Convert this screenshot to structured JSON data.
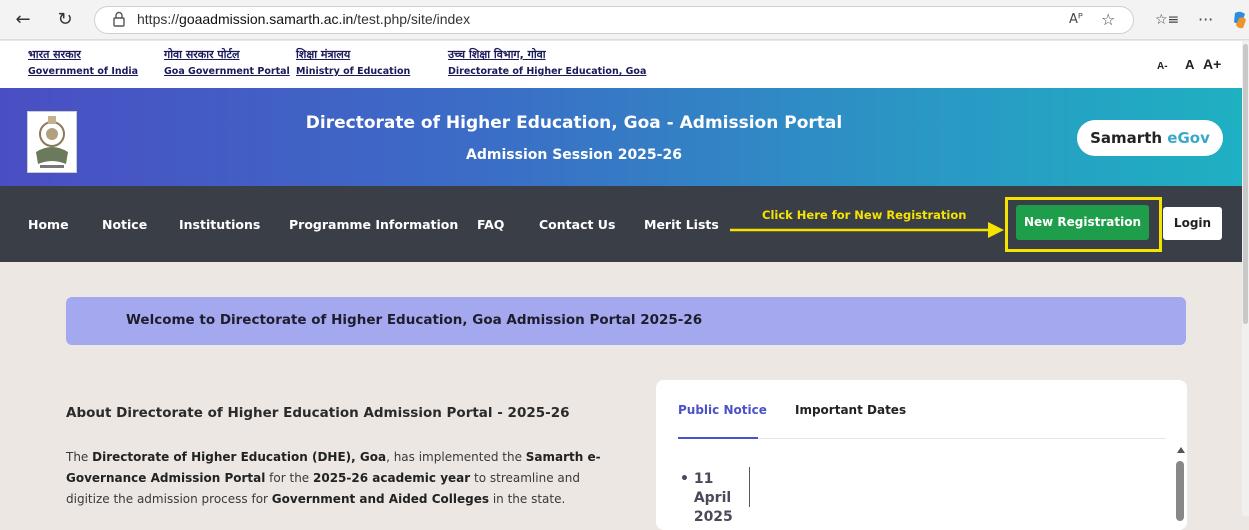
{
  "browser": {
    "url_prefix": "https://",
    "url_host": "goaadmission.samarth.ac.in",
    "url_path": "/test.php/site/index",
    "read_aloud": "Aᴾ",
    "star": "☆",
    "favorites": "☆≡",
    "more": "···"
  },
  "gov_links": [
    {
      "hi": "भारत सरकार",
      "en": "Government of India"
    },
    {
      "hi": "गोवा सरकार पोर्टल",
      "en": "Goa Government Portal"
    },
    {
      "hi": "शिक्षा मंत्रालय",
      "en": "Ministry of Education"
    },
    {
      "hi": "उच्च शिक्षा विभाग, गोवा",
      "en": "Directorate of Higher Education, Goa"
    }
  ],
  "font_controls": {
    "small": "A-",
    "normal": "A",
    "large": "A+"
  },
  "header": {
    "title": "Directorate of Higher Education, Goa - Admission Portal",
    "subtitle": "Admission Session 2025-26",
    "brand_a": "Samarth",
    "brand_b": "eGov"
  },
  "nav": {
    "items": [
      "Home",
      "Notice",
      "Institutions",
      "Programme Information",
      "FAQ",
      "Contact Us",
      "Merit Lists"
    ],
    "callout": "Click Here for New Registration",
    "new_registration": "New Registration",
    "login": "Login"
  },
  "welcome": "Welcome to Directorate of Higher Education, Goa Admission Portal 2025-26",
  "about": {
    "heading": "About Directorate of Higher Education Admission Portal - 2025-26",
    "p1": "The ",
    "b1": "Directorate of Higher Education (DHE), Goa",
    "p2": ", has implemented the ",
    "b2": "Samarth e-Governance Admission Portal",
    "p3": " for the ",
    "b3": "2025-26 academic year",
    "p4": " to streamline and digitize the admission process for ",
    "b4": "Government and Aided Colleges",
    "p5": " in the state."
  },
  "notice_panel": {
    "tabs": [
      "Public Notice",
      "Important Dates"
    ],
    "items": [
      {
        "date": "11 April 2025"
      }
    ]
  },
  "colors": {
    "nav_bg": "#3a3f47",
    "highlight": "#f5e400",
    "new_reg_bg": "#1e9e4a",
    "welcome_bg": "#a4a9ef",
    "tab_active": "#4a52c8"
  }
}
